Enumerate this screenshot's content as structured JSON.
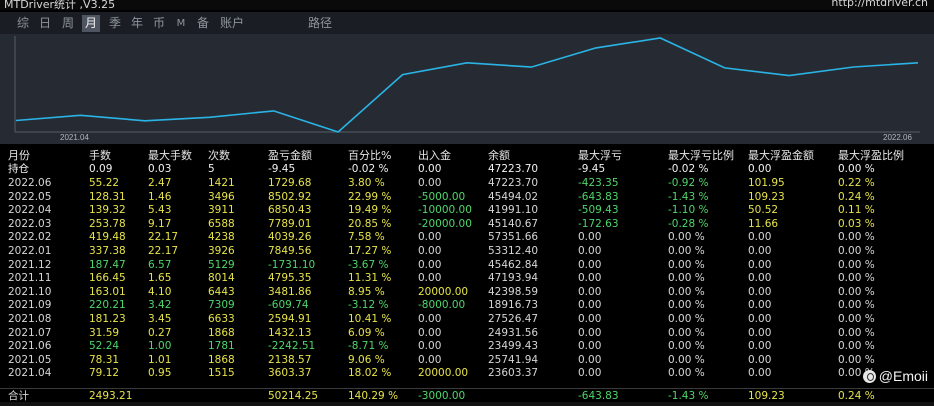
{
  "title": {
    "app": "MTDriver统计 ,V3.25",
    "url": "http://mtdriver.cn"
  },
  "tabs": [
    {
      "label": "综",
      "active": false
    },
    {
      "label": "日",
      "active": false
    },
    {
      "label": "周",
      "active": false
    },
    {
      "label": "月",
      "active": true
    },
    {
      "label": "季",
      "active": false
    },
    {
      "label": "年",
      "active": false
    },
    {
      "label": "币",
      "active": false
    },
    {
      "label": "M",
      "active": false
    },
    {
      "label": "备",
      "active": false
    },
    {
      "label": "账户",
      "active": false
    },
    {
      "label": "路径",
      "active": false
    }
  ],
  "chart": {
    "x_start": "2021.04",
    "x_end": "2022.06",
    "line_color": "#2ab4e6",
    "balance": [
      23603.37,
      25741.94,
      23499.43,
      24931.56,
      27526.47,
      18916.73,
      42398.59,
      47193.94,
      45462.84,
      53312.4,
      57351.66,
      45140.67,
      41991.1,
      45494.02,
      47223.7
    ]
  },
  "table": {
    "headers": [
      "月份",
      "手数",
      "最大手数",
      "次数",
      "盈亏金额",
      "百分比%",
      "出入金",
      "余额",
      "最大浮亏",
      "最大浮亏比例",
      "最大浮盈金额",
      "最大浮盈比例"
    ],
    "holding": {
      "label": "持仓",
      "values": [
        "0.09",
        "0.03",
        "5",
        "-9.45",
        "-0.02 %",
        "0.00",
        "47223.70",
        "-9.45",
        "-0.02 %",
        "0.00",
        "0.00 %"
      ]
    },
    "rows": [
      {
        "month": "2022.06",
        "values": [
          "55.22",
          "2.47",
          "1421",
          "1729.68",
          "3.80 %",
          "0.00",
          "47223.70",
          "-423.35",
          "-0.92 %",
          "101.95",
          "0.22 %"
        ]
      },
      {
        "month": "2022.05",
        "values": [
          "128.31",
          "1.46",
          "3496",
          "8502.92",
          "22.99 %",
          "-5000.00",
          "45494.02",
          "-643.83",
          "-1.43 %",
          "109.23",
          "0.24 %"
        ]
      },
      {
        "month": "2022.04",
        "values": [
          "139.32",
          "5.43",
          "3911",
          "6850.43",
          "19.49 %",
          "-10000.00",
          "41991.10",
          "-509.43",
          "-1.10 %",
          "50.52",
          "0.11 %"
        ]
      },
      {
        "month": "2022.03",
        "values": [
          "253.78",
          "9.17",
          "6588",
          "7789.01",
          "20.85 %",
          "-20000.00",
          "45140.67",
          "-172.63",
          "-0.28 %",
          "11.66",
          "0.03 %"
        ]
      },
      {
        "month": "2022.02",
        "values": [
          "419.48",
          "22.17",
          "4238",
          "4039.26",
          "7.58 %",
          "0.00",
          "57351.66",
          "0.00",
          "0.00 %",
          "0.00",
          "0.00 %"
        ]
      },
      {
        "month": "2022.01",
        "values": [
          "337.38",
          "22.17",
          "3926",
          "7849.56",
          "17.27 %",
          "0.00",
          "53312.40",
          "0.00",
          "0.00 %",
          "0.00",
          "0.00 %"
        ]
      },
      {
        "month": "2021.12",
        "values": [
          "187.47",
          "6.57",
          "5129",
          "-1731.10",
          "-3.67 %",
          "0.00",
          "45462.84",
          "0.00",
          "0.00 %",
          "0.00",
          "0.00 %"
        ]
      },
      {
        "month": "2021.11",
        "values": [
          "166.45",
          "1.65",
          "8014",
          "4795.35",
          "11.31 %",
          "0.00",
          "47193.94",
          "0.00",
          "0.00 %",
          "0.00",
          "0.00 %"
        ]
      },
      {
        "month": "2021.10",
        "values": [
          "163.01",
          "4.10",
          "6443",
          "3481.86",
          "8.95 %",
          "20000.00",
          "42398.59",
          "0.00",
          "0.00 %",
          "0.00",
          "0.00 %"
        ]
      },
      {
        "month": "2021.09",
        "values": [
          "220.21",
          "3.42",
          "7309",
          "-609.74",
          "-3.12 %",
          "-8000.00",
          "18916.73",
          "0.00",
          "0.00 %",
          "0.00",
          "0.00 %"
        ]
      },
      {
        "month": "2021.08",
        "values": [
          "181.23",
          "3.45",
          "6633",
          "2594.91",
          "10.41 %",
          "0.00",
          "27526.47",
          "0.00",
          "0.00 %",
          "0.00",
          "0.00 %"
        ]
      },
      {
        "month": "2021.07",
        "values": [
          "31.59",
          "0.27",
          "1868",
          "1432.13",
          "6.09 %",
          "0.00",
          "24931.56",
          "0.00",
          "0.00 %",
          "0.00",
          "0.00 %"
        ]
      },
      {
        "month": "2021.06",
        "values": [
          "52.24",
          "1.00",
          "1781",
          "-2242.51",
          "-8.71 %",
          "0.00",
          "23499.43",
          "0.00",
          "0.00 %",
          "0.00",
          "0.00 %"
        ]
      },
      {
        "month": "2021.05",
        "values": [
          "78.31",
          "1.01",
          "1868",
          "2138.57",
          "9.06 %",
          "0.00",
          "25741.94",
          "0.00",
          "0.00 %",
          "0.00",
          "0.00 %"
        ]
      },
      {
        "month": "2021.04",
        "values": [
          "79.12",
          "0.95",
          "1515",
          "3603.37",
          "18.02 %",
          "20000.00",
          "23603.37",
          "0.00",
          "0.00 %",
          "0.00",
          "0.00 %"
        ]
      }
    ],
    "total": {
      "label": "合计",
      "values": [
        "2493.21",
        "",
        "",
        "50214.25",
        "140.29 %",
        "-3000.00",
        "",
        "-643.83",
        "-1.43 %",
        "109.23",
        "0.24 %"
      ]
    }
  },
  "watermark": {
    "text": "@Emoii",
    "icon": "watermark-logo-icon"
  },
  "colors": {
    "positive": "#e6e34a",
    "negative": "#4ed66a",
    "neutral": "#d6d6d6",
    "cyan": "#6fe0c8"
  }
}
